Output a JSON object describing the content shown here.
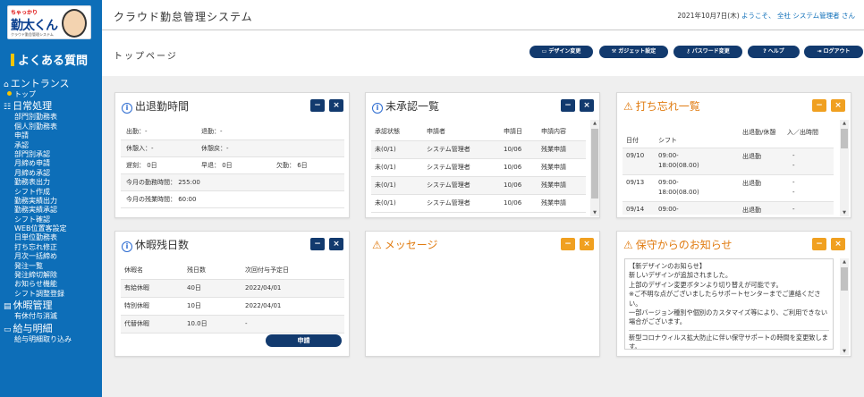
{
  "sidebar": {
    "logo": {
      "mini": "ちゃっかり",
      "big": "勤太くん",
      "sub": "クラウド勤怠管理システム"
    },
    "faq": "よくある質問",
    "sections": [
      {
        "label": "エントランス",
        "icon": "home-icon",
        "items": [
          {
            "label": "トップ",
            "current": true
          }
        ]
      },
      {
        "label": "日常処理",
        "icon": "list-icon",
        "items": [
          {
            "label": "部門別勤務表"
          },
          {
            "label": "個人別勤務表"
          },
          {
            "label": "申請"
          },
          {
            "label": "承認"
          },
          {
            "label": "部門別承認"
          },
          {
            "label": "月締め申請"
          },
          {
            "label": "月締め承認"
          },
          {
            "label": "勤務表出力"
          },
          {
            "label": "シフト作成"
          },
          {
            "label": "勤務実績出力"
          },
          {
            "label": "勤務実績承認"
          },
          {
            "label": "シフト確認"
          },
          {
            "label": "WEB位置客設定"
          },
          {
            "label": "日単位勤務表"
          },
          {
            "label": "打ち忘れ修正"
          },
          {
            "label": "月次一括締め"
          },
          {
            "label": "発注一覧"
          },
          {
            "label": "発注締切解除"
          },
          {
            "label": "お知らせ機能"
          },
          {
            "label": "シフト調整登録"
          }
        ]
      },
      {
        "label": "休暇管理",
        "icon": "calendar-icon",
        "items": [
          {
            "label": "有休付与消滅"
          }
        ]
      },
      {
        "label": "給与明細",
        "icon": "card-icon",
        "items": [
          {
            "label": "給与明細取り込み"
          }
        ]
      }
    ]
  },
  "header": {
    "title": "クラウド勤怠管理システム",
    "date": "2021年10月7日(木)",
    "welcome": "ようこそ、",
    "org": "全社",
    "user": "システム管理者",
    "honorific": "さん"
  },
  "page_title": "トップページ",
  "toolbar": [
    {
      "label": "デザイン変更",
      "icon": "folder-icon"
    },
    {
      "label": "ガジェット設定",
      "icon": "wrench-icon"
    },
    {
      "label": "パスワード変更",
      "icon": "key-icon"
    },
    {
      "label": "ヘルプ",
      "icon": "help-icon"
    },
    {
      "label": "ログアウト",
      "icon": "logout-icon"
    }
  ],
  "attendance": {
    "title": "出退勤時間",
    "clock_in": "出勤：-",
    "clock_out": "退勤：-",
    "break_in": "休憩入：-",
    "break_out": "休憩戻：-",
    "late": "遅刻： 0日",
    "early": "早退： 0日",
    "absent": "欠勤： 6日",
    "month_work": "今月の勤務時間： 255:00",
    "month_overtime": "今月の残業時間： 60:00"
  },
  "leave": {
    "title": "休暇残日数",
    "headers": [
      "休暇名",
      "残日数",
      "次回付与予定日"
    ],
    "rows": [
      [
        "有給休暇",
        "40日",
        "2022/04/01"
      ],
      [
        "特別休暇",
        "10日",
        "2022/04/01"
      ],
      [
        "代替休暇",
        "10.0日",
        "-"
      ]
    ],
    "apply_label": "申請"
  },
  "unapproved": {
    "title": "未承認一覧",
    "headers": [
      "承認状態",
      "申請者",
      "申請日",
      "申請内容"
    ],
    "rows": [
      [
        "未(0/1)",
        "システム管理者",
        "10/06",
        "残業申請"
      ],
      [
        "未(0/1)",
        "システム管理者",
        "10/06",
        "残業申請"
      ],
      [
        "未(0/1)",
        "システム管理者",
        "10/06",
        "残業申請"
      ],
      [
        "未(0/1)",
        "システム管理者",
        "10/06",
        "残業申請"
      ]
    ]
  },
  "message": {
    "title": "メッセージ"
  },
  "forgotten": {
    "title": "打ち忘れ一覧",
    "headers": [
      "日付",
      "シフト",
      "出退勤/休憩",
      "入／出時間"
    ],
    "rows": [
      {
        "date": "09/10",
        "shift1": "09:00-",
        "shift2": "18:00(08.00)",
        "type": "出退勤",
        "t1": "-",
        "t2": "-"
      },
      {
        "date": "09/13",
        "shift1": "09:00-",
        "shift2": "18:00(08.00)",
        "type": "出退勤",
        "t1": "-",
        "t2": "-"
      },
      {
        "date": "09/14",
        "shift1": "09:00-",
        "shift2": "",
        "type": "出退勤",
        "t1": "-",
        "t2": ""
      }
    ]
  },
  "maintenance": {
    "title": "保守からのお知らせ",
    "block1": "【新デザインのお知らせ】\n新しいデザインが追加されました。\n上部のデザイン変更ボタンより切り替えが可能です。\n※ご不明な点がございましたらサポートセンターまでご連絡ください。\n一部バージョン種別や個別のカスタマイズ等により、ご利用できない場合がございます。",
    "block2": "新型コロナウィルス拡大防止に伴い保守サポートの時間を変更致します。\n【変更内容】サポート時間"
  },
  "colors": {
    "sidebar": "#0d6eb8",
    "navy": "#123a6e",
    "orange": "#f0a020",
    "warn_title": "#e07b10",
    "info": "#2a6ad0"
  }
}
